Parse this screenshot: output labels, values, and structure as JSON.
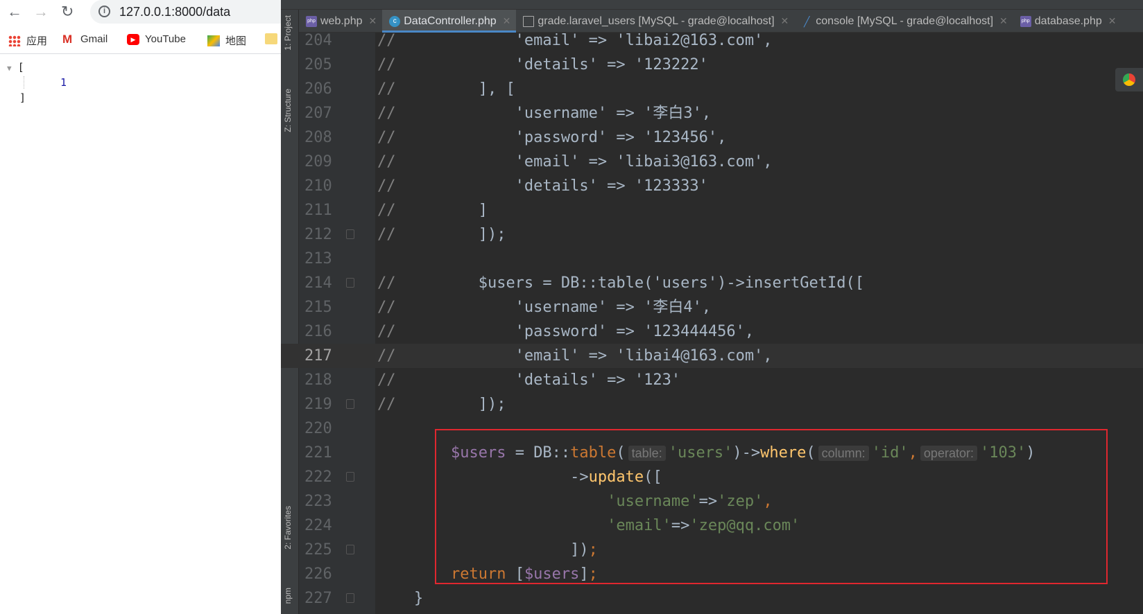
{
  "browser": {
    "url": "127.0.0.1:8000/data",
    "bookmarks": [
      "应用",
      "Gmail",
      "YouTube",
      "地图"
    ],
    "json_open": "[",
    "json_value": "1",
    "json_close": "]"
  },
  "ide": {
    "tool_windows": [
      "1: Project",
      "Z: Structure",
      "2: Favorites",
      "npm"
    ],
    "tabs": [
      {
        "label": "web.php",
        "icon": "php-file-icon",
        "active": false
      },
      {
        "label": "DataController.php",
        "icon": "class-icon",
        "active": true
      },
      {
        "label": "grade.laravel_users [MySQL - grade@localhost]",
        "icon": "table-icon",
        "active": false
      },
      {
        "label": "console [MySQL - grade@localhost]",
        "icon": "console-icon",
        "active": false
      },
      {
        "label": "database.php",
        "icon": "php-file-icon",
        "active": false
      }
    ],
    "current_line": 217,
    "lines": [
      {
        "n": 204,
        "t": [
          [
            "cm",
            "//"
          ],
          [
            "def",
            "             'email' => 'libai2@163.com',"
          ]
        ]
      },
      {
        "n": 205,
        "t": [
          [
            "cm",
            "//"
          ],
          [
            "def",
            "             'details' => '123222'"
          ]
        ]
      },
      {
        "n": 206,
        "t": [
          [
            "cm",
            "//"
          ],
          [
            "def",
            "         ], ["
          ]
        ]
      },
      {
        "n": 207,
        "t": [
          [
            "cm",
            "//"
          ],
          [
            "def",
            "             'username' => '李白3',"
          ]
        ]
      },
      {
        "n": 208,
        "t": [
          [
            "cm",
            "//"
          ],
          [
            "def",
            "             'password' => '123456',"
          ]
        ]
      },
      {
        "n": 209,
        "t": [
          [
            "cm",
            "//"
          ],
          [
            "def",
            "             'email' => 'libai3@163.com',"
          ]
        ]
      },
      {
        "n": 210,
        "t": [
          [
            "cm",
            "//"
          ],
          [
            "def",
            "             'details' => '123333'"
          ]
        ]
      },
      {
        "n": 211,
        "t": [
          [
            "cm",
            "//"
          ],
          [
            "def",
            "         ]"
          ]
        ]
      },
      {
        "n": 212,
        "t": [
          [
            "cm",
            "//"
          ],
          [
            "def",
            "         ]);"
          ]
        ],
        "fold": true
      },
      {
        "n": 213,
        "t": []
      },
      {
        "n": 214,
        "t": [
          [
            "cm",
            "//"
          ],
          [
            "def",
            "         $users = DB::table('users')->insertGetId(["
          ]
        ],
        "fold": true
      },
      {
        "n": 215,
        "t": [
          [
            "cm",
            "//"
          ],
          [
            "def",
            "             'username' => '李白4',"
          ]
        ]
      },
      {
        "n": 216,
        "t": [
          [
            "cm",
            "//"
          ],
          [
            "def",
            "             'password' => '123444456',"
          ]
        ]
      },
      {
        "n": 217,
        "t": [
          [
            "cm",
            "//"
          ],
          [
            "def",
            "             'email' => 'libai4@163.com',"
          ]
        ]
      },
      {
        "n": 218,
        "t": [
          [
            "cm",
            "//"
          ],
          [
            "def",
            "             'details' => '123'"
          ]
        ]
      },
      {
        "n": 219,
        "t": [
          [
            "cm",
            "//"
          ],
          [
            "def",
            "         ]);"
          ]
        ],
        "fold": true
      },
      {
        "n": 220,
        "t": []
      },
      {
        "n": 221,
        "t": [
          [
            "def",
            "        "
          ],
          [
            "var",
            "$users"
          ],
          [
            "def",
            " = DB::"
          ],
          [
            "fn2",
            "table"
          ],
          [
            "def",
            "("
          ],
          [
            "hint",
            "table:"
          ],
          [
            "str",
            "'users'"
          ],
          [
            "def",
            ")->"
          ],
          [
            "fn",
            "where"
          ],
          [
            "def",
            "("
          ],
          [
            "hint",
            "column:"
          ],
          [
            "str",
            "'id'"
          ],
          [
            "kw",
            ","
          ],
          [
            "hint",
            "operator:"
          ],
          [
            "str",
            "'103'"
          ],
          [
            "def",
            ")"
          ]
        ]
      },
      {
        "n": 222,
        "t": [
          [
            "def",
            "                     ->"
          ],
          [
            "fn",
            "update"
          ],
          [
            "def",
            "(["
          ]
        ],
        "fold": true
      },
      {
        "n": 223,
        "t": [
          [
            "def",
            "                         "
          ],
          [
            "str",
            "'username'"
          ],
          [
            "def",
            "=>"
          ],
          [
            "str",
            "'zep'"
          ],
          [
            "kw",
            ","
          ]
        ]
      },
      {
        "n": 224,
        "t": [
          [
            "def",
            "                         "
          ],
          [
            "str",
            "'email'"
          ],
          [
            "def",
            "=>"
          ],
          [
            "str",
            "'zep@qq.com'"
          ]
        ]
      },
      {
        "n": 225,
        "t": [
          [
            "def",
            "                     ])"
          ],
          [
            "kw",
            ";"
          ]
        ],
        "fold": true
      },
      {
        "n": 226,
        "t": [
          [
            "def",
            "        "
          ],
          [
            "kw",
            "return "
          ],
          [
            "def",
            "["
          ],
          [
            "var",
            "$users"
          ],
          [
            "def",
            "]"
          ],
          [
            "kw",
            ";"
          ]
        ]
      },
      {
        "n": 227,
        "t": [
          [
            "def",
            "    }"
          ]
        ],
        "fold": true
      }
    ]
  },
  "colors": {
    "highlight_box": "#e0272f",
    "active_tab_underline": "#4a88c7"
  }
}
